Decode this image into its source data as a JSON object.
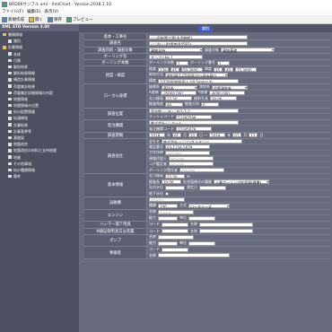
{
  "window": {
    "title": "BRD06サンプル.xml - XmlChart - Version.2018.1.10"
  },
  "menu": [
    "ファイル(F)",
    "編集(E)",
    "表示(V)"
  ],
  "toolbar": {
    "new_label": "新規作成",
    "open_label": "開く",
    "save_label": "保存",
    "preview_label": "プレビュー"
  },
  "sidebar": {
    "header": "XML STD Version 3.00",
    "items": [
      {
        "label": "書類情報",
        "level": 0,
        "kind": "folder"
      },
      {
        "label": "識別",
        "level": 1,
        "kind": "doc"
      },
      {
        "label": "計算情報",
        "level": 0,
        "kind": "folder"
      },
      {
        "label": "本体",
        "level": 1,
        "kind": "doc"
      },
      {
        "label": "付属",
        "level": 1,
        "kind": "doc"
      },
      {
        "label": "解析結果",
        "level": 1,
        "kind": "doc"
      },
      {
        "label": "解析結果情報",
        "level": 1,
        "kind": "doc"
      },
      {
        "label": "構造計算情報",
        "level": 1,
        "kind": "doc"
      },
      {
        "label": "荷重集計結果",
        "level": 1,
        "kind": "doc"
      },
      {
        "label": "荷重集計詳細情報の内容",
        "level": 1,
        "kind": "doc"
      },
      {
        "label": "地盤情報",
        "level": 1,
        "kind": "doc"
      },
      {
        "label": "地盤情報の位置",
        "level": 1,
        "kind": "doc"
      },
      {
        "label": "杭の配置情報",
        "level": 1,
        "kind": "doc"
      },
      {
        "label": "杭頭補強",
        "level": 1,
        "kind": "doc"
      },
      {
        "label": "計算結果",
        "level": 1,
        "kind": "doc"
      },
      {
        "label": "計算基準等",
        "level": 1,
        "kind": "doc"
      },
      {
        "label": "基礎梁",
        "level": 1,
        "kind": "doc"
      },
      {
        "label": "地盤改良",
        "level": 1,
        "kind": "doc"
      },
      {
        "label": "地盤改良の材料と支持地盤",
        "level": 1,
        "kind": "doc"
      },
      {
        "label": "地業",
        "level": 1,
        "kind": "doc"
      },
      {
        "label": "その他事項",
        "level": 1,
        "kind": "doc"
      },
      {
        "label": "杭の種類情報",
        "level": 1,
        "kind": "doc"
      },
      {
        "label": "備考",
        "level": 1,
        "kind": "doc"
      }
    ]
  },
  "main": {
    "tab": "識別",
    "rows": [
      {
        "label": "基本・工事名",
        "lines": [
          {
            "parts": [
              {
                "t": "in",
                "v": "○○邸新築工事(木造軸組)",
                "w": 110
              }
            ]
          }
        ]
      },
      {
        "label": "調査名",
        "lines": [
          {
            "parts": [
              {
                "t": "in",
                "v": "○○市△△町調査(K4583)",
                "w": 110
              }
            ]
          }
        ]
      },
      {
        "label": "調査目的・調査対象",
        "lines": [
          {
            "parts": [
              {
                "t": "sel",
                "v": "建物支持",
                "w": 60
              },
              {
                "t": "txt",
                "v": "調査対象"
              },
              {
                "t": "sel",
                "v": "建物基礎",
                "w": 60
              }
            ]
          }
        ]
      },
      {
        "label": "ボーリング名",
        "lines": [
          {
            "parts": [
              {
                "t": "in",
                "v": "サンプルNo.1",
                "w": 60
              }
            ]
          }
        ]
      },
      {
        "label": "ボーリング本数",
        "lines": [
          {
            "parts": [
              {
                "t": "txt",
                "v": "ボーリング本数"
              },
              {
                "t": "in",
                "v": "1",
                "w": 14
              },
              {
                "t": "txt",
                "v": "ボーリング番号"
              },
              {
                "t": "in",
                "v": "1",
                "w": 14
              }
            ]
          }
        ]
      },
      {
        "label": "経度・緯度",
        "lines": [
          {
            "parts": [
              {
                "t": "txt",
                "v": "経度"
              },
              {
                "t": "in",
                "v": "139",
                "w": 12
              },
              {
                "t": "in",
                "v": "45",
                "w": 10
              },
              {
                "t": "in",
                "v": "50.3000",
                "w": 24
              },
              {
                "t": "txt",
                "v": "緯度"
              },
              {
                "t": "in",
                "v": "35",
                "w": 10
              },
              {
                "t": "in",
                "v": "40",
                "w": 10
              },
              {
                "t": "in",
                "v": "15.3000",
                "w": 24
              }
            ]
          },
          {
            "parts": [
              {
                "t": "txt",
                "v": "取得方法"
              },
              {
                "t": "sel",
                "v": "地形図(1/25000)から読み取り",
                "w": 70
              }
            ]
          },
          {
            "parts": [
              {
                "t": "txt",
                "v": "精度"
              },
              {
                "t": "in",
                "v": "1/25000地形図上で0.5mm以内",
                "w": 90
              }
            ]
          }
        ]
      },
      {
        "label": "ローカル座標",
        "lines": [
          {
            "parts": [
              {
                "t": "txt",
                "v": "座標系"
              },
              {
                "t": "sel",
                "v": "第IX系",
                "w": 40
              },
              {
                "t": "txt",
                "v": "測地系"
              },
              {
                "t": "sel",
                "v": "世界測地系",
                "w": 40
              }
            ]
          },
          {
            "parts": [
              {
                "t": "txt",
                "v": "X座標"
              },
              {
                "t": "in",
                "v": "-35000.000",
                "w": 40
              },
              {
                "t": "txt",
                "v": "Y座標"
              },
              {
                "t": "in",
                "v": "-6000.000",
                "w": 40
              }
            ]
          },
          {
            "parts": [
              {
                "t": "txt",
                "v": "孔口標高"
              },
              {
                "t": "in",
                "v": "12.50",
                "w": 30
              },
              {
                "t": "txt",
                "v": "総削孔長"
              },
              {
                "t": "in",
                "v": "20.00",
                "w": 30
              }
            ]
          },
          {
            "parts": [
              {
                "t": "txt",
                "v": "掘進角度"
              },
              {
                "t": "in",
                "v": "90",
                "w": 20
              },
              {
                "t": "txt",
                "v": "掘進方向"
              },
              {
                "t": "in",
                "v": "0",
                "w": 20
              }
            ]
          }
        ]
      },
      {
        "label": "調査位置",
        "lines": [
          {
            "parts": [
              {
                "t": "in",
                "v": "東京都○○市△△町1-2-3",
                "w": 100
              }
            ]
          },
          {
            "parts": [
              {
                "t": "txt",
                "v": "メッシュコード"
              },
              {
                "t": "in",
                "v": "53393599",
                "w": 40
              }
            ]
          }
        ]
      },
      {
        "label": "発注機関",
        "lines": [
          {
            "parts": [
              {
                "t": "in",
                "v": "株式会社○○ホーム",
                "w": 100
              }
            ]
          },
          {
            "parts": [
              {
                "t": "txt",
                "v": "発注機関コード"
              },
              {
                "t": "in",
                "v": "12345678",
                "w": 40
              }
            ]
          }
        ]
      },
      {
        "label": "調査期間",
        "lines": [
          {
            "parts": [
              {
                "t": "in",
                "v": "2018",
                "w": 18
              },
              {
                "t": "txt",
                "v": "年"
              },
              {
                "t": "in",
                "v": "01",
                "w": 10
              },
              {
                "t": "txt",
                "v": "月"
              },
              {
                "t": "in",
                "v": "10",
                "w": 10
              },
              {
                "t": "txt",
                "v": "日 ～"
              },
              {
                "t": "in",
                "v": "2018",
                "w": 18
              },
              {
                "t": "txt",
                "v": "年"
              },
              {
                "t": "in",
                "v": "01",
                "w": 10
              },
              {
                "t": "txt",
                "v": "月"
              },
              {
                "t": "in",
                "v": "12",
                "w": 10
              },
              {
                "t": "txt",
                "v": "日"
              }
            ]
          }
        ]
      },
      {
        "label": "調査会社",
        "lines": [
          {
            "parts": [
              {
                "t": "txt",
                "v": "会社名"
              },
              {
                "t": "in",
                "v": "株式会社○○コンサルタンツ",
                "w": 90
              }
            ]
          },
          {
            "parts": [
              {
                "t": "txt",
                "v": "電話番号"
              },
              {
                "t": "in",
                "v": "03-1234-5678",
                "w": 50
              }
            ]
          },
          {
            "parts": [
              {
                "t": "txt",
                "v": "主任技師"
              },
              {
                "t": "in",
                "v": "○○ ○○",
                "w": 50
              }
            ]
          },
          {
            "parts": [
              {
                "t": "txt",
                "v": "現場代理人"
              },
              {
                "t": "in",
                "v": "○○ ○○",
                "w": 50
              }
            ]
          },
          {
            "parts": [
              {
                "t": "txt",
                "v": "コア鑑定者"
              },
              {
                "t": "in",
                "v": "○○ ○○",
                "w": 50
              }
            ]
          },
          {
            "parts": [
              {
                "t": "txt",
                "v": "ボーリング責任者"
              },
              {
                "t": "in",
                "v": "○○ ○○",
                "w": 50
              }
            ]
          }
        ]
      },
      {
        "label": "基本情報",
        "lines": [
          {
            "parts": [
              {
                "t": "txt",
                "v": "孔口標高"
              },
              {
                "t": "in",
                "v": "12.50",
                "w": 22
              },
              {
                "t": "txt",
                "v": "m"
              }
            ]
          },
          {
            "parts": [
              {
                "t": "txt",
                "v": "掘進長"
              },
              {
                "t": "in",
                "v": "20.00",
                "w": 22
              },
              {
                "t": "txt",
                "v": "柱状図様式の種類"
              },
              {
                "t": "sel",
                "v": "土質ボーリング柱状図(標準)",
                "w": 62
              }
            ]
          },
          {
            "parts": [
              {
                "t": "txt",
                "v": "孔内水位"
              },
              {
                "t": "in",
                "v": "",
                "w": 22
              },
              {
                "t": "txt",
                "v": "測定日"
              },
              {
                "t": "in",
                "v": "",
                "w": 30
              }
            ]
          },
          {
            "parts": [
              {
                "t": "txt",
                "v": "地下水位"
              },
              {
                "t": "chk",
                "v": ""
              }
            ]
          }
        ]
      },
      {
        "label": "試錐機",
        "lines": [
          {
            "parts": [
              {
                "t": "in",
                "v": "○○○○",
                "w": 40
              }
            ]
          },
          {
            "parts": [
              {
                "t": "txt",
                "v": "種類"
              },
              {
                "t": "in",
                "v": "100",
                "w": 22
              },
              {
                "t": "txt",
                "v": "方式"
              },
              {
                "t": "sel",
                "v": "ロータリー式",
                "w": 46
              }
            ]
          }
        ]
      },
      {
        "label": "エンジン",
        "lines": [
          {
            "parts": [
              {
                "t": "txt",
                "v": "名称"
              },
              {
                "t": "in",
                "v": "△△△△",
                "w": 40
              }
            ]
          },
          {
            "parts": [
              {
                "t": "txt",
                "v": "能力"
              },
              {
                "t": "in",
                "v": "",
                "w": 22
              },
              {
                "t": "txt",
                "v": "単位"
              },
              {
                "t": "in",
                "v": "",
                "w": 30
              }
            ]
          }
        ]
      },
      {
        "label": "ハンマー落下用具",
        "lines": [
          {
            "parts": [
              {
                "t": "txt",
                "v": "コード"
              },
              {
                "t": "in",
                "v": "",
                "w": 30
              },
              {
                "t": "txt",
                "v": "名称"
              },
              {
                "t": "in",
                "v": "",
                "w": 60
              }
            ]
          }
        ]
      },
      {
        "label": "N値記録用具又は装置",
        "lines": [
          {
            "parts": [
              {
                "t": "txt",
                "v": "コード"
              },
              {
                "t": "in",
                "v": "",
                "w": 30
              },
              {
                "t": "txt",
                "v": "名称"
              },
              {
                "t": "in",
                "v": "",
                "w": 60
              }
            ]
          }
        ]
      },
      {
        "label": "ポンプ",
        "lines": [
          {
            "parts": [
              {
                "t": "txt",
                "v": "名称"
              },
              {
                "t": "in",
                "v": "",
                "w": 40
              }
            ]
          },
          {
            "parts": [
              {
                "t": "txt",
                "v": "能力"
              },
              {
                "t": "in",
                "v": "",
                "w": 22
              },
              {
                "t": "txt",
                "v": "単位"
              },
              {
                "t": "in",
                "v": "",
                "w": 30
              }
            ]
          }
        ]
      },
      {
        "label": "事業者",
        "lines": [
          {
            "parts": [
              {
                "t": "txt",
                "v": "コード"
              },
              {
                "t": "in",
                "v": "",
                "w": 30
              }
            ]
          },
          {
            "parts": [
              {
                "t": "txt",
                "v": "名称"
              },
              {
                "t": "in",
                "v": "",
                "w": 80
              }
            ]
          }
        ]
      }
    ]
  }
}
